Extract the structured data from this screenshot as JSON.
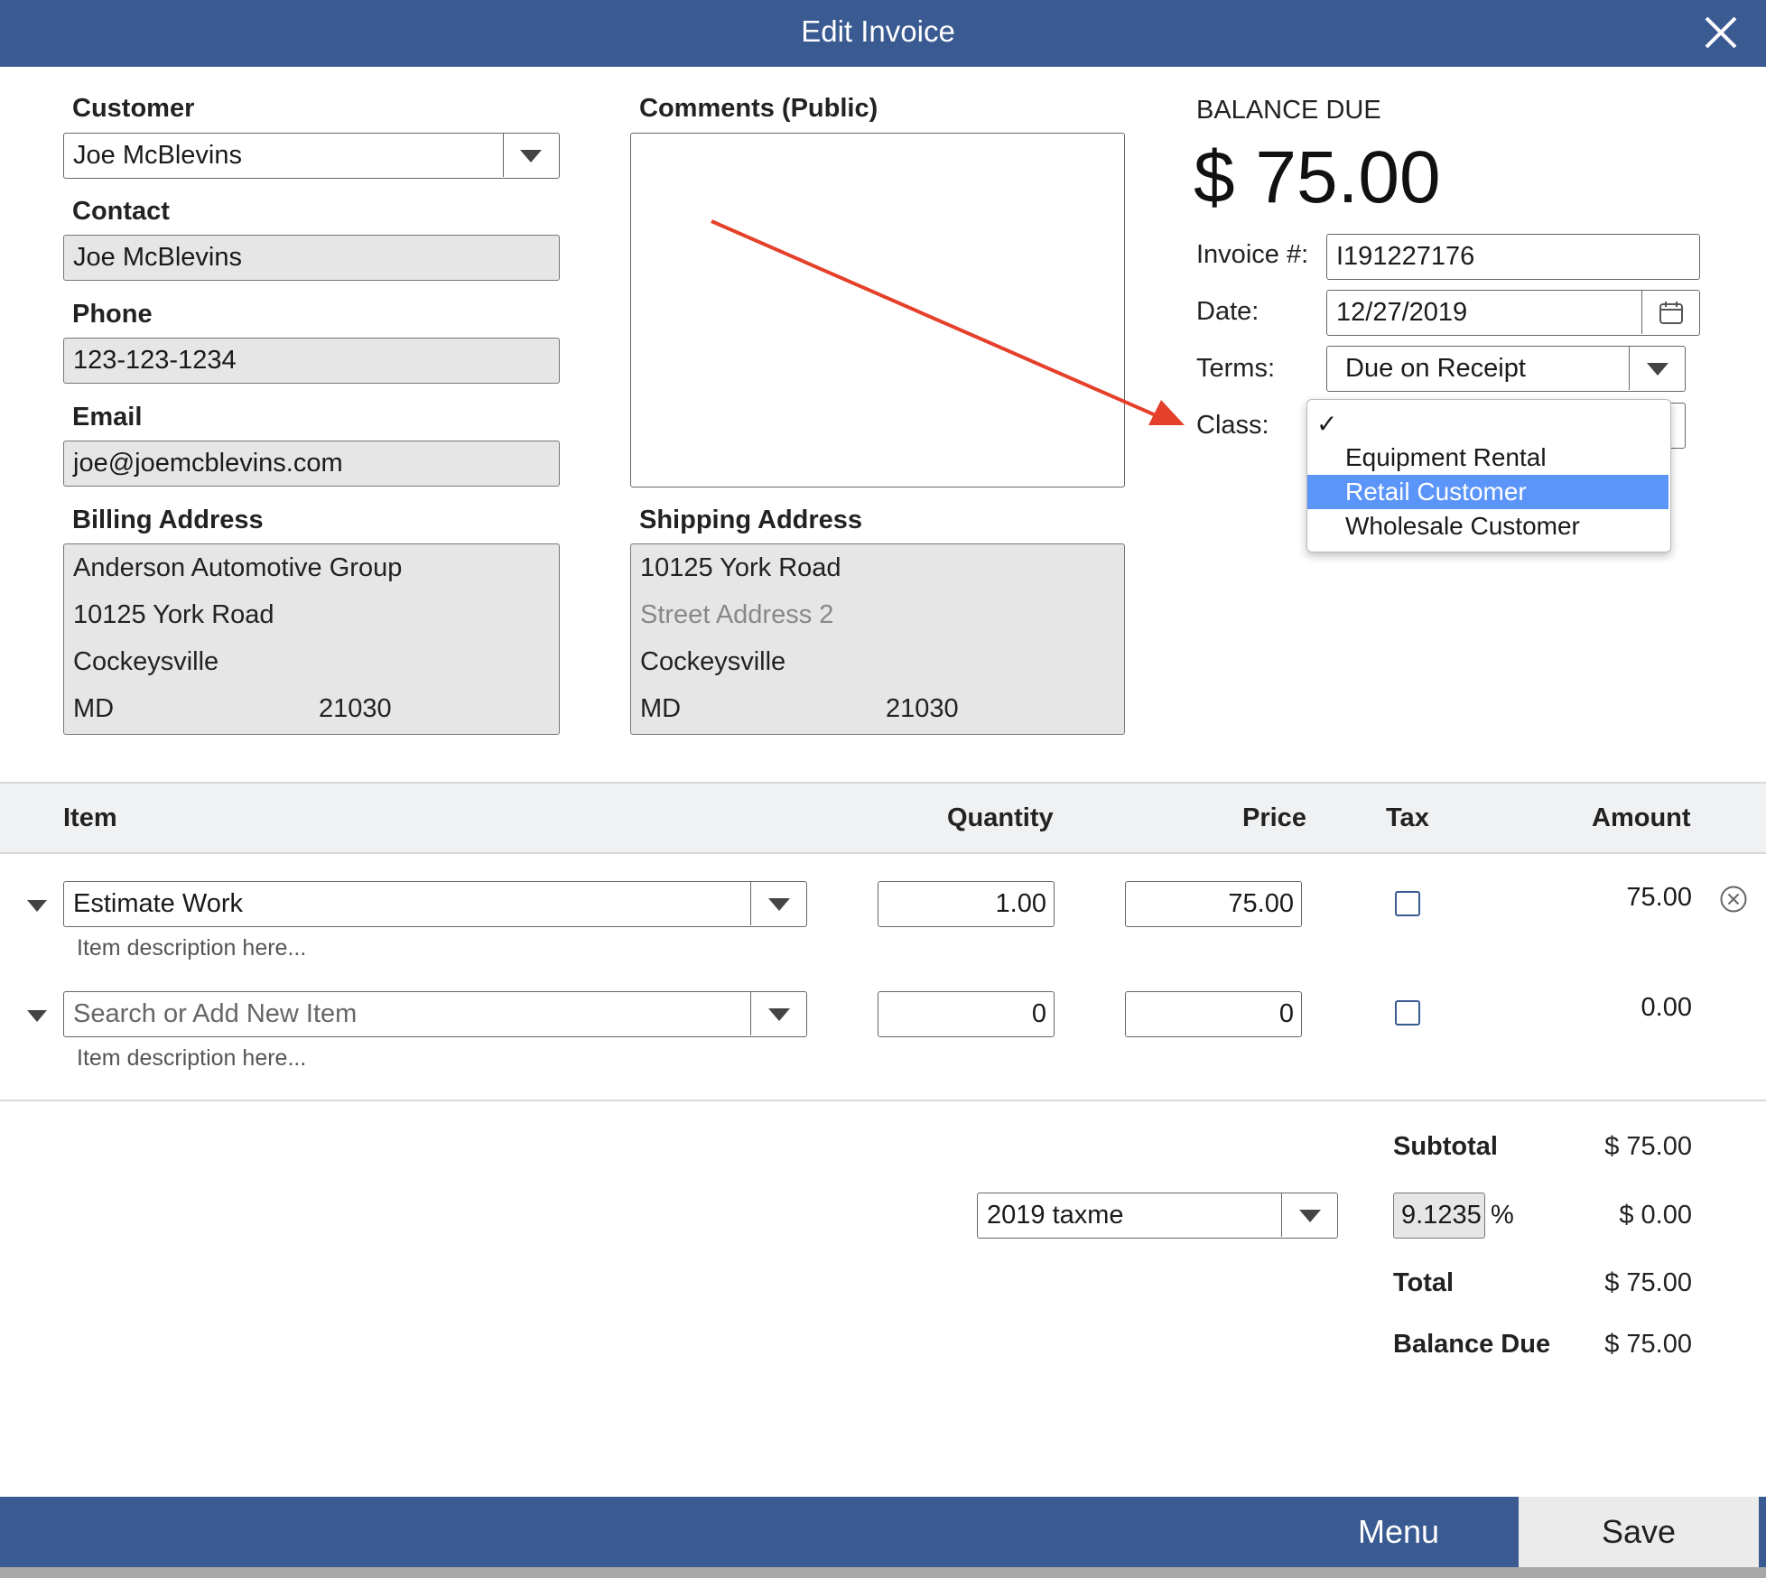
{
  "window": {
    "title": "Edit Invoice"
  },
  "customer": {
    "label": "Customer",
    "value": "Joe McBlevins",
    "contact_label": "Contact",
    "contact_value": "Joe McBlevins",
    "phone_label": "Phone",
    "phone_value": "123-123-1234",
    "email_label": "Email",
    "email_value": "joe@joemcblevins.com"
  },
  "billing": {
    "label": "Billing Address",
    "line1": "Anderson Automotive Group",
    "line2": "10125 York Road",
    "city": "Cockeysville",
    "state": "MD",
    "zip": "21030"
  },
  "comments": {
    "label": "Comments (Public)",
    "value": ""
  },
  "shipping": {
    "label": "Shipping Address",
    "line1": "10125 York Road",
    "line2_placeholder": "Street Address 2",
    "city": "Cockeysville",
    "state": "MD",
    "zip": "21030"
  },
  "balance": {
    "label": "BALANCE DUE",
    "amount": "$ 75.00"
  },
  "invoice": {
    "number_label": "Invoice #:",
    "number_value": "I191227176",
    "date_label": "Date:",
    "date_value": "12/27/2019",
    "terms_label": "Terms:",
    "terms_value": "Due on Receipt",
    "class_label": "Class:",
    "class_options": [
      {
        "label": "",
        "checked": true
      },
      {
        "label": "Equipment Rental"
      },
      {
        "label": "Retail Customer",
        "highlighted": true
      },
      {
        "label": "Wholesale Customer"
      }
    ],
    "check_mark": "✓"
  },
  "table": {
    "headers": {
      "item": "Item",
      "quantity": "Quantity",
      "price": "Price",
      "tax": "Tax",
      "amount": "Amount"
    },
    "rows": [
      {
        "item": "Estimate Work",
        "description_placeholder": "Item description here...",
        "quantity": "1.00",
        "price": "75.00",
        "tax": false,
        "amount": "75.00"
      },
      {
        "item_placeholder": "Search or Add New Item",
        "description_placeholder": "Item description here...",
        "quantity": "0",
        "price": "0",
        "tax": false,
        "amount": "0.00"
      }
    ]
  },
  "totals": {
    "subtotal_label": "Subtotal",
    "subtotal_value": "$ 75.00",
    "tax_name": "2019 taxme",
    "tax_rate": "9.1235",
    "percent_sign": "%",
    "tax_value": "$ 0.00",
    "total_label": "Total",
    "total_value": "$ 75.00",
    "balance_label": "Balance Due",
    "balance_value": "$ 75.00"
  },
  "footer": {
    "menu_label": "Menu",
    "save_label": "Save"
  },
  "colors": {
    "header": "#3a5a92",
    "highlight": "#5b95f9",
    "annotation_arrow": "#e4402a"
  }
}
